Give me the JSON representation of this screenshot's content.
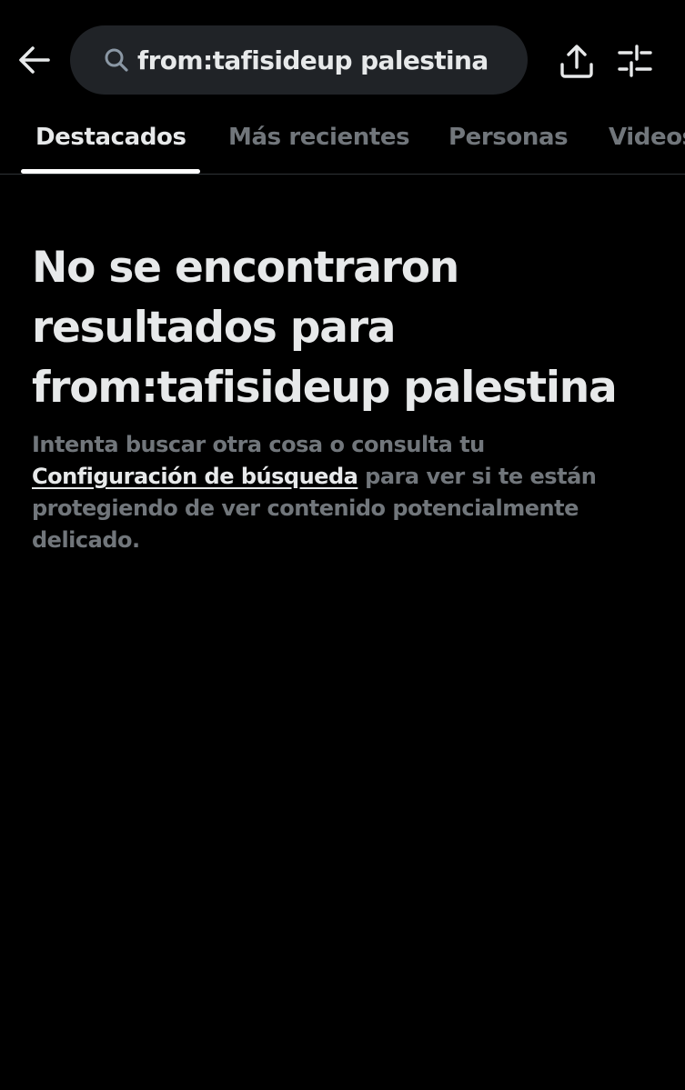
{
  "header": {
    "back_icon": "arrow-left-icon",
    "search": {
      "icon": "search-icon",
      "query": "from:tafisideup palestina"
    },
    "share_icon": "share-upload-icon",
    "filter_icon": "sliders-filter-icon"
  },
  "tabs": [
    {
      "label": "Destacados",
      "active": true
    },
    {
      "label": "Más recientes",
      "active": false
    },
    {
      "label": "Personas",
      "active": false
    },
    {
      "label": "Videos",
      "active": false
    }
  ],
  "empty_state": {
    "title": "No se encontraron resultados para from:tafisideup palestina",
    "body_prefix": "Intenta buscar otra cosa o consulta tu ",
    "link_label": "Configuración de búsqueda",
    "body_suffix": " para ver si te están protegiendo de ver contenido potencialmente delicado."
  },
  "colors": {
    "background": "#000000",
    "primary_text": "#e7e9ea",
    "secondary_text": "#71767b",
    "search_field": "#202327",
    "divider": "#2f3336"
  }
}
